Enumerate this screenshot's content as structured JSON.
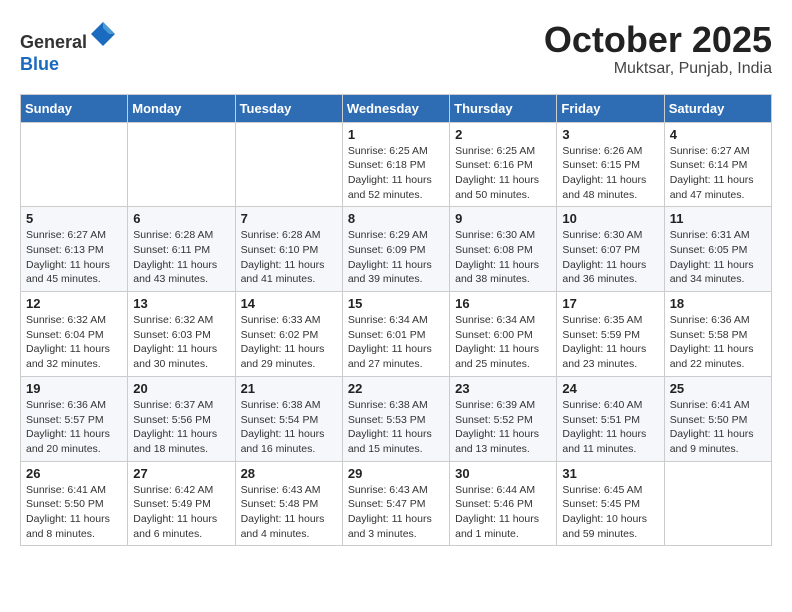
{
  "header": {
    "logo_line1": "General",
    "logo_line2": "Blue",
    "month": "October 2025",
    "location": "Muktsar, Punjab, India"
  },
  "weekdays": [
    "Sunday",
    "Monday",
    "Tuesday",
    "Wednesday",
    "Thursday",
    "Friday",
    "Saturday"
  ],
  "weeks": [
    [
      {
        "day": "",
        "info": ""
      },
      {
        "day": "",
        "info": ""
      },
      {
        "day": "",
        "info": ""
      },
      {
        "day": "1",
        "info": "Sunrise: 6:25 AM\nSunset: 6:18 PM\nDaylight: 11 hours\nand 52 minutes."
      },
      {
        "day": "2",
        "info": "Sunrise: 6:25 AM\nSunset: 6:16 PM\nDaylight: 11 hours\nand 50 minutes."
      },
      {
        "day": "3",
        "info": "Sunrise: 6:26 AM\nSunset: 6:15 PM\nDaylight: 11 hours\nand 48 minutes."
      },
      {
        "day": "4",
        "info": "Sunrise: 6:27 AM\nSunset: 6:14 PM\nDaylight: 11 hours\nand 47 minutes."
      }
    ],
    [
      {
        "day": "5",
        "info": "Sunrise: 6:27 AM\nSunset: 6:13 PM\nDaylight: 11 hours\nand 45 minutes."
      },
      {
        "day": "6",
        "info": "Sunrise: 6:28 AM\nSunset: 6:11 PM\nDaylight: 11 hours\nand 43 minutes."
      },
      {
        "day": "7",
        "info": "Sunrise: 6:28 AM\nSunset: 6:10 PM\nDaylight: 11 hours\nand 41 minutes."
      },
      {
        "day": "8",
        "info": "Sunrise: 6:29 AM\nSunset: 6:09 PM\nDaylight: 11 hours\nand 39 minutes."
      },
      {
        "day": "9",
        "info": "Sunrise: 6:30 AM\nSunset: 6:08 PM\nDaylight: 11 hours\nand 38 minutes."
      },
      {
        "day": "10",
        "info": "Sunrise: 6:30 AM\nSunset: 6:07 PM\nDaylight: 11 hours\nand 36 minutes."
      },
      {
        "day": "11",
        "info": "Sunrise: 6:31 AM\nSunset: 6:05 PM\nDaylight: 11 hours\nand 34 minutes."
      }
    ],
    [
      {
        "day": "12",
        "info": "Sunrise: 6:32 AM\nSunset: 6:04 PM\nDaylight: 11 hours\nand 32 minutes."
      },
      {
        "day": "13",
        "info": "Sunrise: 6:32 AM\nSunset: 6:03 PM\nDaylight: 11 hours\nand 30 minutes."
      },
      {
        "day": "14",
        "info": "Sunrise: 6:33 AM\nSunset: 6:02 PM\nDaylight: 11 hours\nand 29 minutes."
      },
      {
        "day": "15",
        "info": "Sunrise: 6:34 AM\nSunset: 6:01 PM\nDaylight: 11 hours\nand 27 minutes."
      },
      {
        "day": "16",
        "info": "Sunrise: 6:34 AM\nSunset: 6:00 PM\nDaylight: 11 hours\nand 25 minutes."
      },
      {
        "day": "17",
        "info": "Sunrise: 6:35 AM\nSunset: 5:59 PM\nDaylight: 11 hours\nand 23 minutes."
      },
      {
        "day": "18",
        "info": "Sunrise: 6:36 AM\nSunset: 5:58 PM\nDaylight: 11 hours\nand 22 minutes."
      }
    ],
    [
      {
        "day": "19",
        "info": "Sunrise: 6:36 AM\nSunset: 5:57 PM\nDaylight: 11 hours\nand 20 minutes."
      },
      {
        "day": "20",
        "info": "Sunrise: 6:37 AM\nSunset: 5:56 PM\nDaylight: 11 hours\nand 18 minutes."
      },
      {
        "day": "21",
        "info": "Sunrise: 6:38 AM\nSunset: 5:54 PM\nDaylight: 11 hours\nand 16 minutes."
      },
      {
        "day": "22",
        "info": "Sunrise: 6:38 AM\nSunset: 5:53 PM\nDaylight: 11 hours\nand 15 minutes."
      },
      {
        "day": "23",
        "info": "Sunrise: 6:39 AM\nSunset: 5:52 PM\nDaylight: 11 hours\nand 13 minutes."
      },
      {
        "day": "24",
        "info": "Sunrise: 6:40 AM\nSunset: 5:51 PM\nDaylight: 11 hours\nand 11 minutes."
      },
      {
        "day": "25",
        "info": "Sunrise: 6:41 AM\nSunset: 5:50 PM\nDaylight: 11 hours\nand 9 minutes."
      }
    ],
    [
      {
        "day": "26",
        "info": "Sunrise: 6:41 AM\nSunset: 5:50 PM\nDaylight: 11 hours\nand 8 minutes."
      },
      {
        "day": "27",
        "info": "Sunrise: 6:42 AM\nSunset: 5:49 PM\nDaylight: 11 hours\nand 6 minutes."
      },
      {
        "day": "28",
        "info": "Sunrise: 6:43 AM\nSunset: 5:48 PM\nDaylight: 11 hours\nand 4 minutes."
      },
      {
        "day": "29",
        "info": "Sunrise: 6:43 AM\nSunset: 5:47 PM\nDaylight: 11 hours\nand 3 minutes."
      },
      {
        "day": "30",
        "info": "Sunrise: 6:44 AM\nSunset: 5:46 PM\nDaylight: 11 hours\nand 1 minute."
      },
      {
        "day": "31",
        "info": "Sunrise: 6:45 AM\nSunset: 5:45 PM\nDaylight: 10 hours\nand 59 minutes."
      },
      {
        "day": "",
        "info": ""
      }
    ]
  ]
}
